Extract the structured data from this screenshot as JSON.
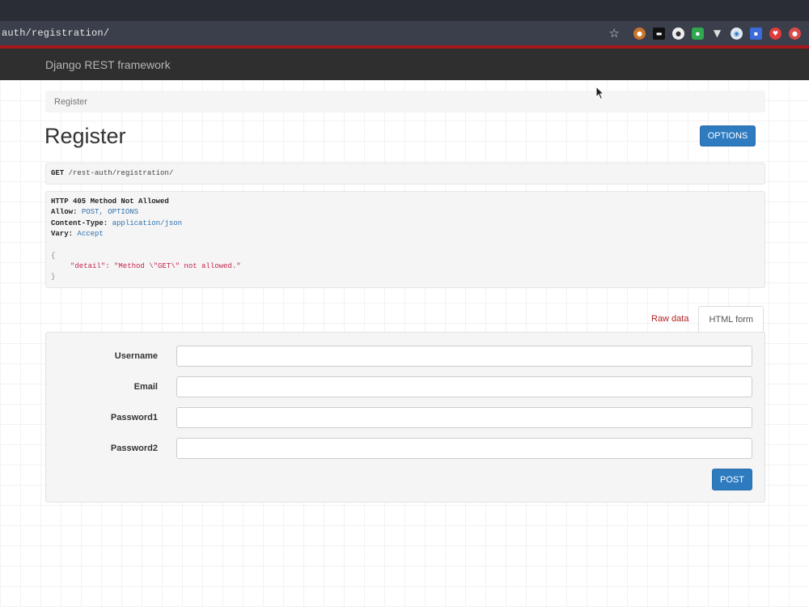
{
  "browser": {
    "url": "auth/registration/",
    "extension_icons": [
      "puzzle-icon",
      "terminal-icon",
      "ghost-icon",
      "grammar-icon",
      "vue-icon",
      "circle-icon",
      "monitor-icon",
      "pocket-icon",
      "profile-icon"
    ]
  },
  "navbar": {
    "brand": "Django REST framework"
  },
  "breadcrumb": {
    "item": "Register"
  },
  "page": {
    "title": "Register",
    "options_label": "OPTIONS"
  },
  "request": {
    "method": "GET",
    "path": "/rest-auth/registration/"
  },
  "response": {
    "status_line": "HTTP 405 Method Not Allowed",
    "headers": [
      {
        "key": "Allow:",
        "value": "POST, OPTIONS"
      },
      {
        "key": "Content-Type:",
        "value": "application/json"
      },
      {
        "key": "Vary:",
        "value": "Accept"
      }
    ],
    "body_open": "{",
    "body_line": "\"detail\": \"Method \\\"GET\\\" not allowed.\"",
    "body_close": "}"
  },
  "tabs": {
    "raw": "Raw data",
    "html": "HTML form"
  },
  "form": {
    "fields": [
      {
        "label": "Username",
        "value": ""
      },
      {
        "label": "Email",
        "value": ""
      },
      {
        "label": "Password1",
        "value": ""
      },
      {
        "label": "Password2",
        "value": ""
      }
    ],
    "submit_label": "POST"
  },
  "colors": {
    "accent": "#2e7bbf",
    "navbar": "#2f2f2f",
    "highlight_red": "#a4171c"
  }
}
